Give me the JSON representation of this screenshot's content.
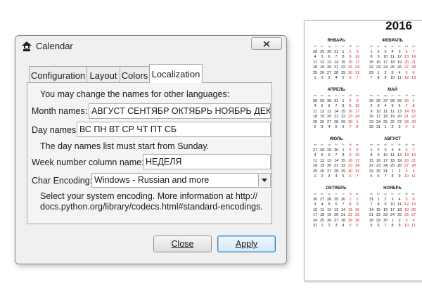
{
  "window": {
    "title": "Calendar"
  },
  "tabs": [
    {
      "label": "Configuration",
      "active": false
    },
    {
      "label": "Layout",
      "active": false
    },
    {
      "label": "Colors",
      "active": false
    },
    {
      "label": "Localization",
      "active": true
    }
  ],
  "localization": {
    "intro": "You may change the names for other languages:",
    "month_names_label": "Month names:",
    "month_names_value": "АВГУСТ СЕНТЯБР ОКТЯБРЬ НОЯБРЬ ДЕКАБРЬ",
    "day_names_label": "Day names:",
    "day_names_value": "ВС ПН ВТ СР ЧТ ПТ СБ",
    "day_names_note": "The day names list must start from Sunday.",
    "week_col_label": "Week number column name:",
    "week_col_value": "НЕДЕЛЯ",
    "encoding_label": "Char Encoding:",
    "encoding_value": "Windows - Russian and more",
    "encoding_note_1": "Select your system encoding. More information at http://",
    "encoding_note_2": "docs.python.org/library/codecs.html#standard-encodings."
  },
  "buttons": {
    "close": "Close",
    "apply": "Apply"
  },
  "colors": {
    "accent": "#3c7fb1",
    "weekend_red": "#d21e1e"
  },
  "calendar": {
    "year": "2016",
    "day_header": [
      "пн",
      "вт",
      "ср",
      "чт",
      "пт",
      "сб",
      "вс"
    ],
    "months": [
      {
        "name": "ЯНВАРЬ",
        "weeks": [
          [
            "28",
            "29",
            "30",
            "31",
            "1",
            "2",
            "3"
          ],
          [
            "4",
            "5",
            "6",
            "7",
            "8",
            "9",
            "10"
          ],
          [
            "11",
            "12",
            "13",
            "14",
            "15",
            "16",
            "17"
          ],
          [
            "18",
            "19",
            "20",
            "21",
            "22",
            "23",
            "24"
          ],
          [
            "25",
            "26",
            "27",
            "28",
            "29",
            "30",
            "31"
          ],
          [
            "1",
            "2",
            "3",
            "4",
            "5",
            "6",
            "7"
          ]
        ]
      },
      {
        "name": "ФЕВРАЛЬ",
        "weeks": [
          [
            "1",
            "2",
            "3",
            "4",
            "5",
            "6",
            "7"
          ],
          [
            "8",
            "9",
            "10",
            "11",
            "12",
            "13",
            "14"
          ],
          [
            "15",
            "16",
            "17",
            "18",
            "19",
            "20",
            "21"
          ],
          [
            "22",
            "23",
            "24",
            "25",
            "26",
            "27",
            "28"
          ],
          [
            "29",
            "1",
            "2",
            "3",
            "4",
            "5",
            "6"
          ],
          [
            "7",
            "8",
            "9",
            "10",
            "11",
            "12",
            "13"
          ]
        ]
      },
      {
        "name": "АПРЕЛЬ",
        "weeks": [
          [
            "28",
            "29",
            "30",
            "31",
            "1",
            "2",
            "3"
          ],
          [
            "4",
            "5",
            "6",
            "7",
            "8",
            "9",
            "10"
          ],
          [
            "11",
            "12",
            "13",
            "14",
            "15",
            "16",
            "17"
          ],
          [
            "18",
            "19",
            "20",
            "21",
            "22",
            "23",
            "24"
          ],
          [
            "25",
            "26",
            "27",
            "28",
            "29",
            "30",
            "1"
          ],
          [
            "2",
            "3",
            "4",
            "5",
            "6",
            "7",
            "8"
          ]
        ]
      },
      {
        "name": "МАЙ",
        "weeks": [
          [
            "25",
            "26",
            "27",
            "28",
            "29",
            "30",
            "1"
          ],
          [
            "2",
            "3",
            "4",
            "5",
            "6",
            "7",
            "8"
          ],
          [
            "9",
            "10",
            "11",
            "12",
            "13",
            "14",
            "15"
          ],
          [
            "16",
            "17",
            "18",
            "19",
            "20",
            "21",
            "22"
          ],
          [
            "23",
            "24",
            "25",
            "26",
            "27",
            "28",
            "29"
          ],
          [
            "30",
            "31",
            "1",
            "2",
            "3",
            "4",
            "5"
          ]
        ]
      },
      {
        "name": "ИЮЛЬ",
        "weeks": [
          [
            "27",
            "28",
            "29",
            "30",
            "1",
            "2",
            "3"
          ],
          [
            "4",
            "5",
            "6",
            "7",
            "8",
            "9",
            "10"
          ],
          [
            "11",
            "12",
            "13",
            "14",
            "15",
            "16",
            "17"
          ],
          [
            "18",
            "19",
            "20",
            "21",
            "22",
            "23",
            "24"
          ],
          [
            "25",
            "26",
            "27",
            "28",
            "29",
            "30",
            "31"
          ],
          [
            "1",
            "2",
            "3",
            "4",
            "5",
            "6",
            "7"
          ]
        ]
      },
      {
        "name": "АВГУСТ",
        "weeks": [
          [
            "1",
            "2",
            "3",
            "4",
            "5",
            "6",
            "7"
          ],
          [
            "8",
            "9",
            "10",
            "11",
            "12",
            "13",
            "14"
          ],
          [
            "15",
            "16",
            "17",
            "18",
            "19",
            "20",
            "21"
          ],
          [
            "22",
            "23",
            "24",
            "25",
            "26",
            "27",
            "28"
          ],
          [
            "29",
            "30",
            "31",
            "1",
            "2",
            "3",
            "4"
          ],
          [
            "5",
            "6",
            "7",
            "8",
            "9",
            "10",
            "11"
          ]
        ]
      },
      {
        "name": "ОКТЯБРЬ",
        "weeks": [
          [
            "26",
            "27",
            "28",
            "29",
            "30",
            "1",
            "2"
          ],
          [
            "3",
            "4",
            "5",
            "6",
            "7",
            "8",
            "9"
          ],
          [
            "10",
            "11",
            "12",
            "13",
            "14",
            "15",
            "16"
          ],
          [
            "17",
            "18",
            "19",
            "20",
            "21",
            "22",
            "23"
          ],
          [
            "24",
            "25",
            "26",
            "27",
            "28",
            "29",
            "30"
          ],
          [
            "31",
            "1",
            "2",
            "3",
            "4",
            "5",
            "6"
          ]
        ]
      },
      {
        "name": "НОЯБРЬ",
        "weeks": [
          [
            "31",
            "1",
            "2",
            "3",
            "4",
            "5",
            "6"
          ],
          [
            "7",
            "8",
            "9",
            "10",
            "11",
            "12",
            "13"
          ],
          [
            "14",
            "15",
            "16",
            "17",
            "18",
            "19",
            "20"
          ],
          [
            "21",
            "22",
            "23",
            "24",
            "25",
            "26",
            "27"
          ],
          [
            "28",
            "29",
            "30",
            "1",
            "2",
            "3",
            "4"
          ],
          [
            "5",
            "6",
            "7",
            "8",
            "9",
            "10",
            "11"
          ]
        ]
      }
    ]
  }
}
